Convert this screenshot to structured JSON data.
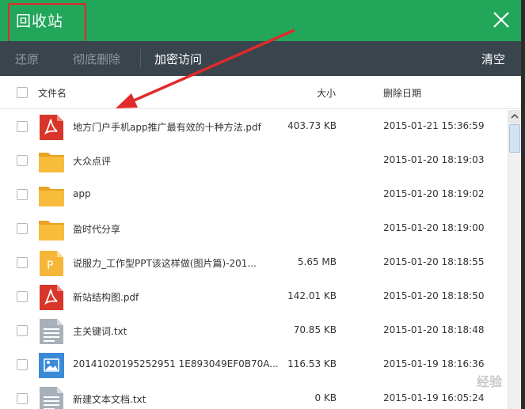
{
  "window": {
    "title": "回收站"
  },
  "toolbar": {
    "restore_label": "还原",
    "delete_label": "彻底删除",
    "encrypt_label": "加密访问",
    "clear_label": "清空"
  },
  "columns": {
    "name": "文件名",
    "size": "大小",
    "date": "删除日期"
  },
  "files": [
    {
      "name": "地方门户手机app推广最有效的十种方法.pdf",
      "size": "403.73 KB",
      "date": "2015-01-21 15:36:59",
      "icon": "pdf-icon"
    },
    {
      "name": "大众点评",
      "size": "",
      "date": "2015-01-20 18:19:03",
      "icon": "folder-icon"
    },
    {
      "name": "app",
      "size": "",
      "date": "2015-01-20 18:19:02",
      "icon": "folder-icon"
    },
    {
      "name": "盈时代分享",
      "size": "",
      "date": "2015-01-20 18:19:00",
      "icon": "folder-icon"
    },
    {
      "name": "说服力_工作型PPT该这样做(图片篇)-201...",
      "size": "5.65 MB",
      "date": "2015-01-20 18:18:55",
      "icon": "ppt-icon"
    },
    {
      "name": "新站结构图.pdf",
      "size": "142.01 KB",
      "date": "2015-01-20 18:18:50",
      "icon": "pdf-icon"
    },
    {
      "name": "主关键词.txt",
      "size": "70.85 KB",
      "date": "2015-01-20 18:18:48",
      "icon": "txt-icon"
    },
    {
      "name": "20141020195252951 1E893049EF0B70A...",
      "size": "116.53 KB",
      "date": "2015-01-19 18:16:36",
      "icon": "image-icon"
    },
    {
      "name": "新建文本文档.txt",
      "size": "0 KB",
      "date": "2015-01-19 16:05:24",
      "icon": "txt-icon"
    }
  ],
  "colors": {
    "titlebar": "#21a65a",
    "toolbar": "#3a444d",
    "annotation": "#e02a2a"
  },
  "watermark": "经验"
}
